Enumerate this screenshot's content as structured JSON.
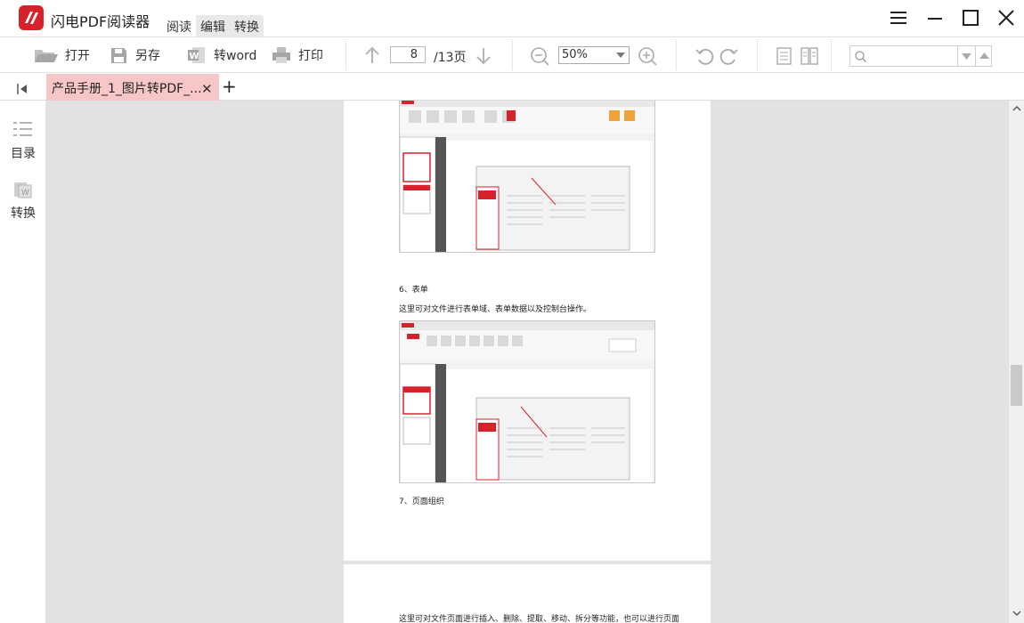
{
  "app": {
    "title": "闪电PDF阅读器"
  },
  "menu_tabs": [
    "阅读",
    "编辑",
    "转换"
  ],
  "toolbar": {
    "open_label": "打开",
    "saveas_label": "另存",
    "toword_label": "转word",
    "print_label": "打印",
    "current_page": "8",
    "total_pages": "/13页",
    "zoom": "50%"
  },
  "tab": {
    "title": "产品手册_1_图片转PDF_...",
    "close": "✕",
    "add": "+"
  },
  "sidebar": {
    "toc_label": "目录",
    "convert_label": "转换"
  },
  "document": {
    "heading6": "6、表单",
    "para6": "这里可对文件进行表单域、表单数据以及控制台操作。",
    "heading7": "7、页面组织",
    "para7": "这里可对文件页面进行插入、删除、提取、移动、拆分等功能，也可以进行页面"
  },
  "colors": {
    "brand": "#d6232b",
    "tab_active": "#f7c6c6",
    "workspace": "#e2e2e2"
  }
}
